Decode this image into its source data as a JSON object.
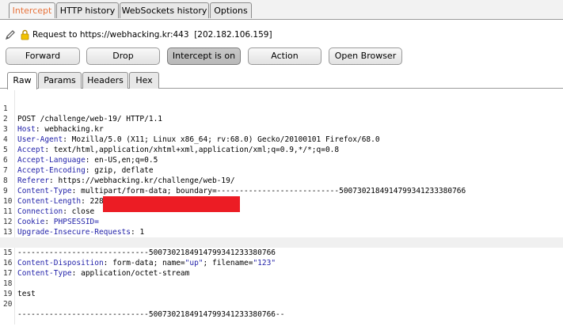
{
  "top_tabs": [
    "Intercept",
    "HTTP history",
    "WebSockets history",
    "Options"
  ],
  "request_line": "Request to https://webhacking.kr:443  [202.182.106.159]",
  "buttons": {
    "forward": "Forward",
    "drop": "Drop",
    "intercept": "Intercept is on",
    "action": "Action",
    "open_browser": "Open Browser"
  },
  "sub_tabs": [
    "Raw",
    "Params",
    "Headers",
    "Hex"
  ],
  "request": {
    "lines": [
      {
        "n": "1",
        "text": "POST /challenge/web-19/ HTTP/1.1"
      },
      {
        "n": "2",
        "key": "Host",
        "val": " webhacking.kr"
      },
      {
        "n": "3",
        "key": "User-Agent",
        "val": " Mozilla/5.0 (X11; Linux x86_64; rv:68.0) Gecko/20100101 Firefox/68.0"
      },
      {
        "n": "4",
        "key": "Accept",
        "val": " text/html,application/xhtml+xml,application/xml;q=0.9,*/*;q=0.8"
      },
      {
        "n": "5",
        "key": "Accept-Language",
        "val": " en-US,en;q=0.5"
      },
      {
        "n": "6",
        "key": "Accept-Encoding",
        "val": " gzip, deflate"
      },
      {
        "n": "7",
        "key": "Referer",
        "val": " https://webhacking.kr/challenge/web-19/"
      },
      {
        "n": "8",
        "key": "Content-Type",
        "val": " multipart/form-data; boundary=---------------------------5007302184914799341233380766"
      },
      {
        "n": "9",
        "key": "Content-Length",
        "val": " 228"
      },
      {
        "n": "10",
        "key": "Connection",
        "val": " close"
      },
      {
        "n": "11",
        "key": "Cookie",
        "val": " PHPSESSID="
      },
      {
        "n": "12",
        "key": "Upgrade-Insecure-Requests",
        "val": " 1"
      },
      {
        "n": "13",
        "text": ""
      },
      {
        "n": "14",
        "text": "-----------------------------5007302184914799341233380766"
      },
      {
        "n": "15",
        "key": "Content-Disposition",
        "val": " form-data; name=",
        "s1": "\"up\"",
        "mid": "; filename=",
        "s2": "\"123\""
      },
      {
        "n": "16",
        "key": "Content-Type",
        "val": " application/octet-stream"
      },
      {
        "n": "17",
        "text": ""
      },
      {
        "n": "18",
        "body": "test"
      },
      {
        "n": "19",
        "text": ""
      },
      {
        "n": "20",
        "text": "-----------------------------5007302184914799341233380766--"
      }
    ]
  },
  "colors": {
    "active_tab": "#e8733b",
    "header_key": "#1f1fa8",
    "body_text": "#a01010",
    "redaction": "#ec1c24"
  }
}
